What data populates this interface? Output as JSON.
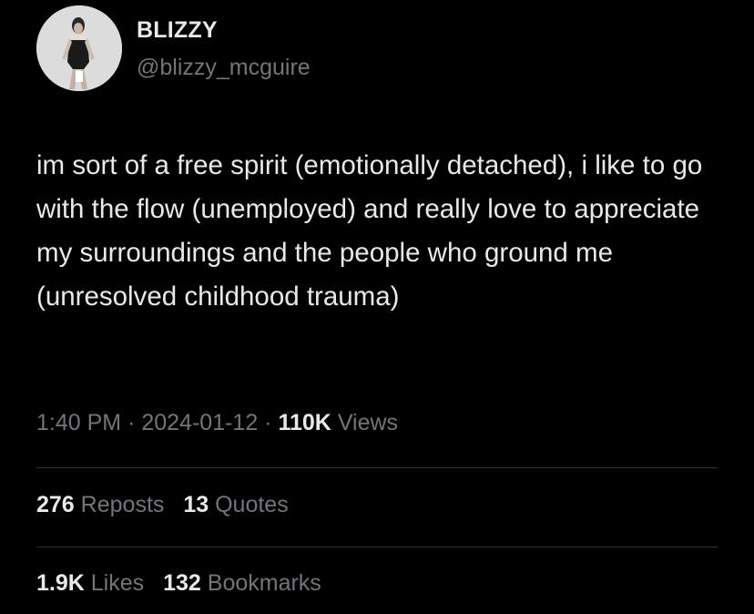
{
  "author": {
    "name": "BLIZZY",
    "handle": "@blizzy_mcguire"
  },
  "tweet": {
    "text": "im sort of a free spirit (emotionally detached), i like to go with the flow (unemployed) and really love to appreciate my surroundings and the people who ground me (unresolved childhood trauma)"
  },
  "meta": {
    "time": "1:40 PM",
    "separator": "·",
    "date": "2024-01-12",
    "views_count": "110K",
    "views_label": "Views"
  },
  "engagement": {
    "reposts_count": "276",
    "reposts_label": "Reposts",
    "quotes_count": "13",
    "quotes_label": "Quotes",
    "likes_count": "1.9K",
    "likes_label": "Likes",
    "bookmarks_count": "132",
    "bookmarks_label": "Bookmarks"
  },
  "colors": {
    "background": "#000000",
    "primary_text": "#e7e9ea",
    "secondary_text": "#71767b",
    "divider": "#2f3336"
  }
}
